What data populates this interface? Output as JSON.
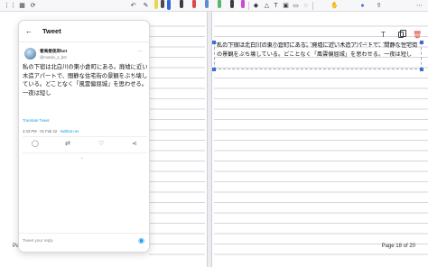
{
  "toolbar": {
    "left_icons": [
      "grid-icon",
      "bookmark-icon",
      "sync-icon"
    ],
    "tool_icons": [
      "pen-icon",
      "eraser-icon",
      "lasso-icon",
      "text-icon",
      "image-icon",
      "mic-icon"
    ],
    "pen_colors": [
      "#e8d84a",
      "#4a4a55",
      "#2f6ad8",
      "#3b3b44",
      "#d84a4a",
      "#5b8ad8",
      "#55b86a",
      "#3b3b44",
      "#c94ad8"
    ]
  },
  "tweet": {
    "header_title": "Tweet",
    "author_name": "春夷昼夜岸bot",
    "author_handle": "@momin_1_bot",
    "body": "私の下宿は北白川の東小倉町にある。廃墟に近い木造アパートで、間静な住宅街の景観をぶち壊している。どことなく「風雲偏屈城」を思わせる。一夜は短し",
    "translate_label": "Translate Tweet",
    "timestamp": "4:43 PM · 01 Feb 22 · ",
    "source": "twittbot.net",
    "reply_placeholder": "Tweet your reply"
  },
  "note": {
    "textbox_text": "私の下宿は北白川の東小倉町にある。廃墟に近い木造アパートで、間静な住宅街の景観をぶち壊している。どことなく「風雲偏屈城」を思わせる。一夜は短し",
    "left_page_label": "Pa",
    "page_number": "Page 18 of 20",
    "accent_color": "#3a6fd8",
    "trash_color": "#e0453a"
  }
}
